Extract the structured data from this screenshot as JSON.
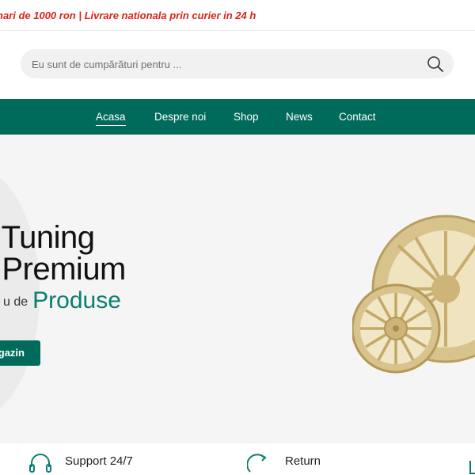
{
  "topbar": {
    "promo": "nari de 1000 ron | Livrare nationala prin curier in 24 h"
  },
  "search": {
    "placeholder": "Eu sunt de cumpărături pentru ..."
  },
  "nav": {
    "items": [
      {
        "label": "Acasa",
        "active": true
      },
      {
        "label": "Despre noi"
      },
      {
        "label": "Shop"
      },
      {
        "label": "News"
      },
      {
        "label": "Contact"
      }
    ]
  },
  "hero": {
    "line1": "e Tuning",
    "line2": "e Premium",
    "sub_prefix": "u de",
    "sub_accent": "Produse",
    "cta": "gazin"
  },
  "features": [
    {
      "label": "Support 24/7",
      "icon": "headset-icon"
    },
    {
      "label": "Return",
      "icon": "return-icon"
    }
  ],
  "colors": {
    "primary": "#006b5b",
    "accent": "#0b7d70",
    "promo": "#d9241b",
    "wheel": "#d8c28a"
  }
}
